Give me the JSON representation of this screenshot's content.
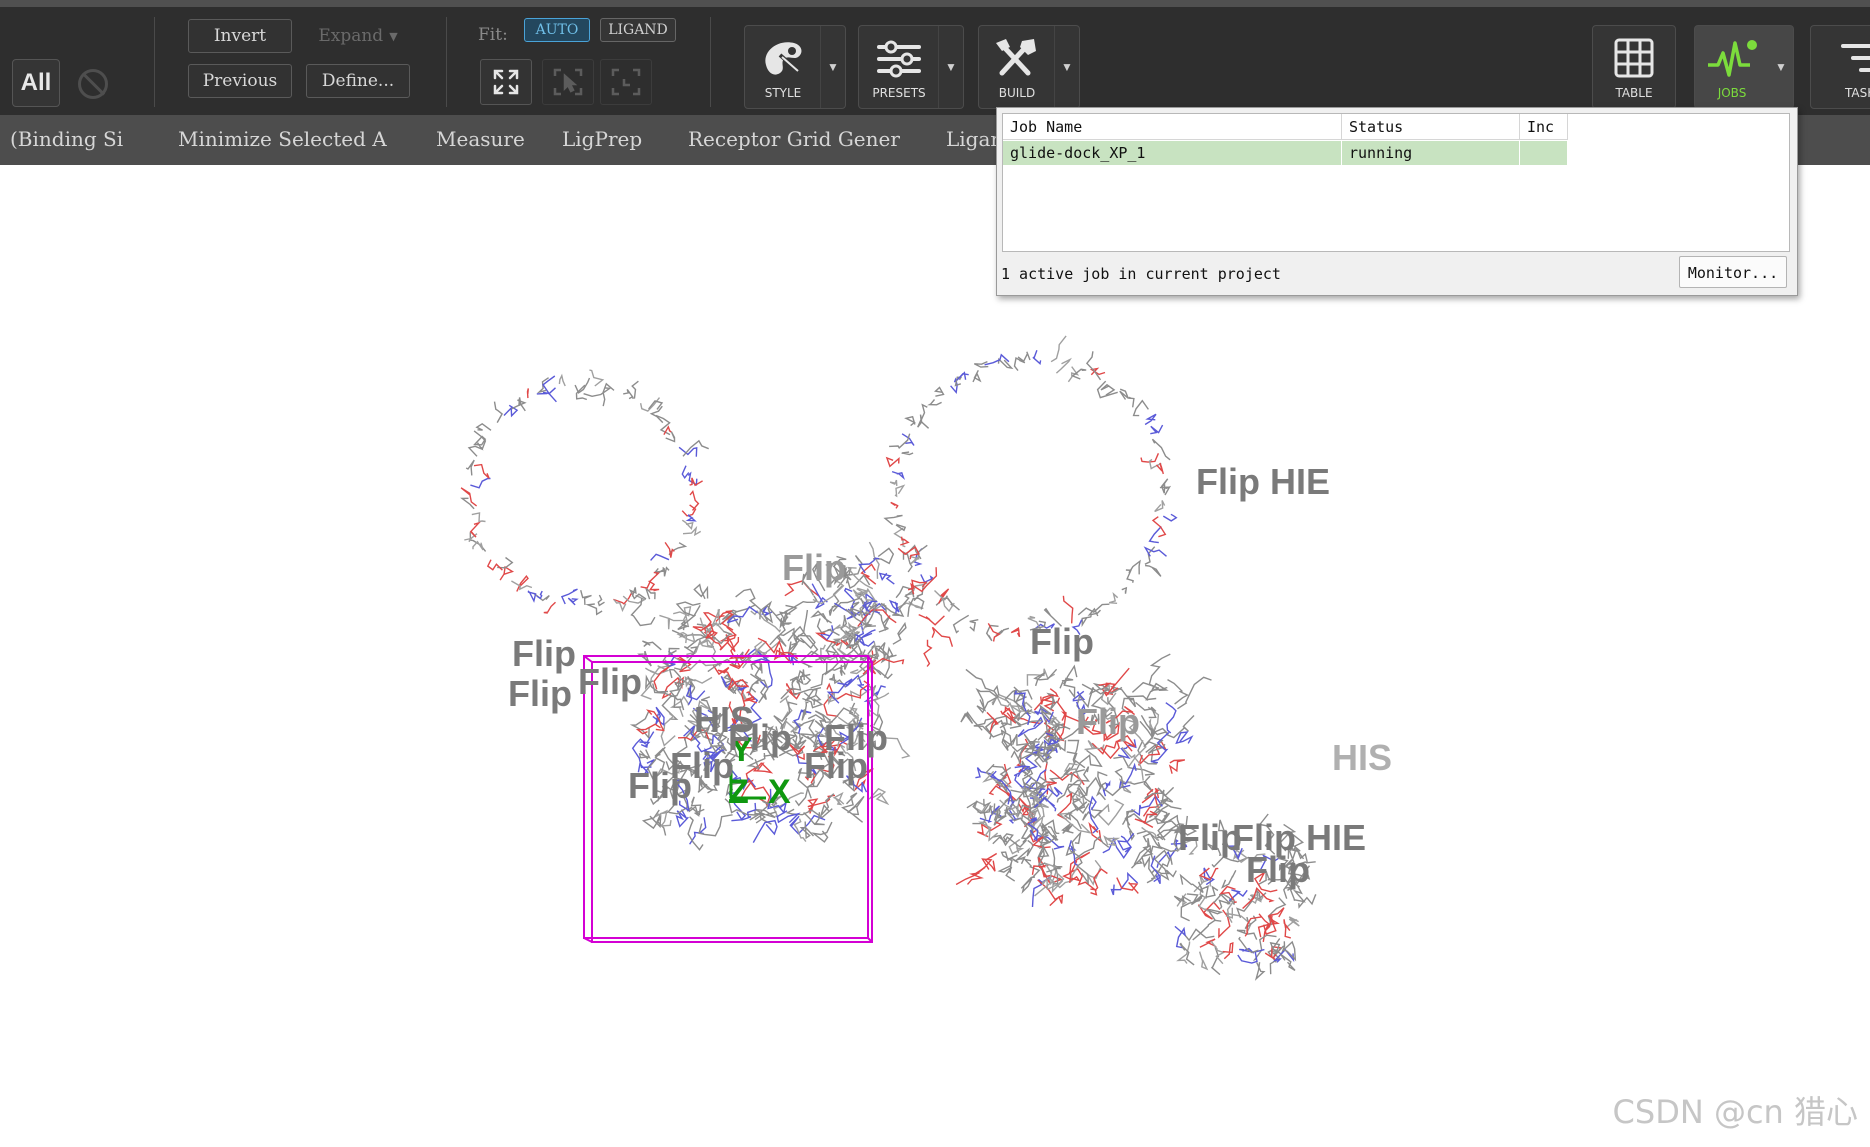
{
  "toolbar": {
    "all_label": "All",
    "invert_label": "Invert",
    "expand_label": "Expand",
    "previous_label": "Previous",
    "define_label": "Define...",
    "fit_label": "Fit:",
    "fit_auto_label": "AUTO",
    "fit_ligand_label": "LIGAND",
    "style_label": "STYLE",
    "presets_label": "PRESETS",
    "build_label": "BUILD",
    "table_label": "TABLE",
    "jobs_label": "JOBS",
    "tasks_label": "TASK"
  },
  "favorites": [
    {
      "label": "(Binding Si"
    },
    {
      "label": "Minimize Selected A"
    },
    {
      "label": "Measure"
    },
    {
      "label": "LigPrep"
    },
    {
      "label": "Receptor Grid Gener"
    },
    {
      "label": "Ligar"
    }
  ],
  "jobs_popup": {
    "columns": [
      "Job Name",
      "Status",
      "Inc"
    ],
    "rows": [
      {
        "name": "glide-dock_XP_1",
        "status": "running",
        "inc": ""
      }
    ],
    "footer": "1 active job in current project",
    "monitor_label": "Monitor..."
  },
  "viewer": {
    "axes": {
      "x": "X",
      "y": "Y",
      "z": "Z"
    },
    "labels": [
      {
        "text": "Flip HIE"
      },
      {
        "text": "Flip"
      },
      {
        "text": "Flip"
      },
      {
        "text": "Flip"
      },
      {
        "text": "Flip"
      },
      {
        "text": "Flip"
      },
      {
        "text": "HIS"
      },
      {
        "text": "Flip"
      },
      {
        "text": "Flip"
      },
      {
        "text": "Flip"
      },
      {
        "text": "Flip"
      },
      {
        "text": "Flip"
      },
      {
        "text": "Flip"
      },
      {
        "text": "HIS"
      },
      {
        "text": "Flip"
      },
      {
        "text": "Flip HIE"
      },
      {
        "text": "Flip"
      }
    ],
    "watermark": "CSDN @cn 猎心"
  },
  "colors": {
    "toolbar_bg": "#2e2e2e",
    "favbar_bg": "#4d4d4d",
    "grid_box": "#d400d4",
    "axis_green": "#109810",
    "job_row_bg": "#c8e3c1",
    "jobs_accent": "#7cdc3c"
  }
}
